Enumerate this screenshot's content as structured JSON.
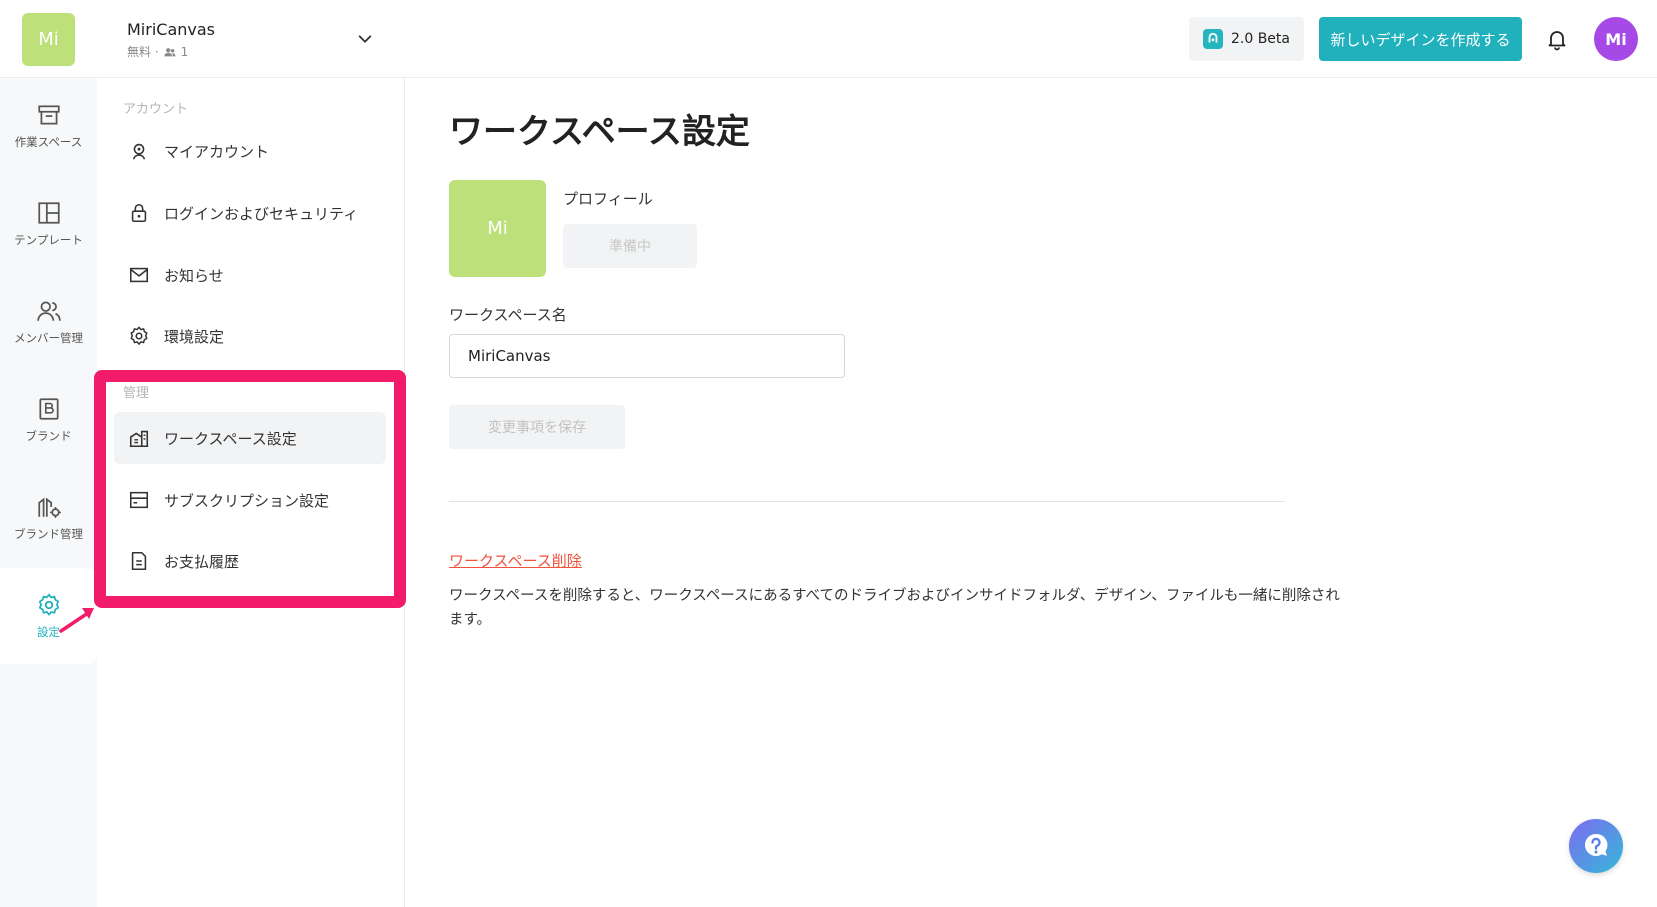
{
  "header": {
    "workspace_logo": "Mi",
    "workspace_name": "MiriCanvas",
    "workspace_plan": "無料 ·",
    "member_count": "1",
    "beta_label": "2.0 Beta",
    "create_label": "新しいデザインを作成する",
    "avatar_initials": "Mi"
  },
  "rail": {
    "items": [
      {
        "label": "作業スペース",
        "icon": "archive-icon"
      },
      {
        "label": "テンプレート",
        "icon": "layout-icon"
      },
      {
        "label": "メンバー管理",
        "icon": "users-icon"
      },
      {
        "label": "ブランド",
        "icon": "brand-icon"
      },
      {
        "label": "ブランド管理",
        "icon": "brand-manage-icon"
      },
      {
        "label": "設定",
        "icon": "gear-icon"
      }
    ]
  },
  "subnav": {
    "account_label": "アカウント",
    "account_items": [
      {
        "label": "マイアカウント",
        "icon": "person-icon"
      },
      {
        "label": "ログインおよびセキュリティ",
        "icon": "lock-icon"
      },
      {
        "label": "お知らせ",
        "icon": "mail-icon"
      },
      {
        "label": "環境設定",
        "icon": "gear-icon"
      }
    ],
    "admin_label": "管理",
    "admin_items": [
      {
        "label": "ワークスペース設定",
        "icon": "building-icon"
      },
      {
        "label": "サブスクリプション設定",
        "icon": "card-icon"
      },
      {
        "label": "お支払履歴",
        "icon": "document-icon"
      }
    ]
  },
  "main": {
    "title": "ワークスペース設定",
    "profile_logo": "Mi",
    "profile_label": "プロフィール",
    "prep_button": "準備中",
    "name_label": "ワークスペース名",
    "name_value": "MiriCanvas",
    "save_button": "変更事項を保存",
    "delete_link": "ワークスペース削除",
    "delete_desc": "ワークスペースを削除すると、ワークスペースにあるすべてのドライブおよびインサイドフォルダ、デザイン、ファイルも一緒に削除されます。"
  },
  "colors": {
    "accent": "#21b1bd",
    "highlight": "#f21c6a",
    "logo": "#bde07a",
    "avatar": "#a649e6",
    "danger": "#f0523c"
  }
}
